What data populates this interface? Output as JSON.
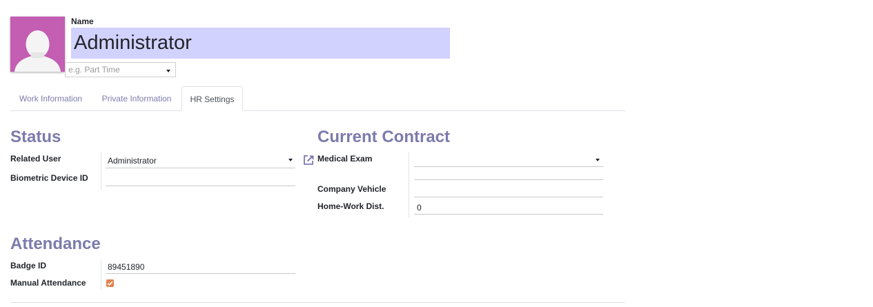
{
  "header": {
    "name_label": "Name",
    "employee_name": "Administrator",
    "job_type_placeholder": "e.g. Part Time"
  },
  "tabs": [
    {
      "label": "Work Information",
      "active": false
    },
    {
      "label": "Private Information",
      "active": false
    },
    {
      "label": "HR Settings",
      "active": true
    }
  ],
  "status": {
    "title": "Status",
    "related_user_label": "Related User",
    "related_user_value": "Administrator",
    "biometric_label": "Biometric Device ID",
    "biometric_value": ""
  },
  "contract": {
    "title": "Current Contract",
    "medical_exam_label": "Medical Exam",
    "medical_exam_value": "",
    "company_vehicle_label": "Company Vehicle",
    "company_vehicle_value": "",
    "home_work_label": "Home-Work Dist.",
    "home_work_value": "0"
  },
  "attendance": {
    "title": "Attendance",
    "badge_label": "Badge ID",
    "badge_value": "89451890",
    "manual_label": "Manual Attendance",
    "manual_checked": true
  },
  "colors": {
    "avatar_bg": "#c35eb3",
    "accent": "#7c7bad",
    "name_highlight": "#d2d2ff",
    "checkbox": "#e5824e"
  },
  "icons": [
    "avatar-silhouette-icon",
    "caret-down-icon",
    "external-link-icon",
    "checkmark-icon"
  ]
}
